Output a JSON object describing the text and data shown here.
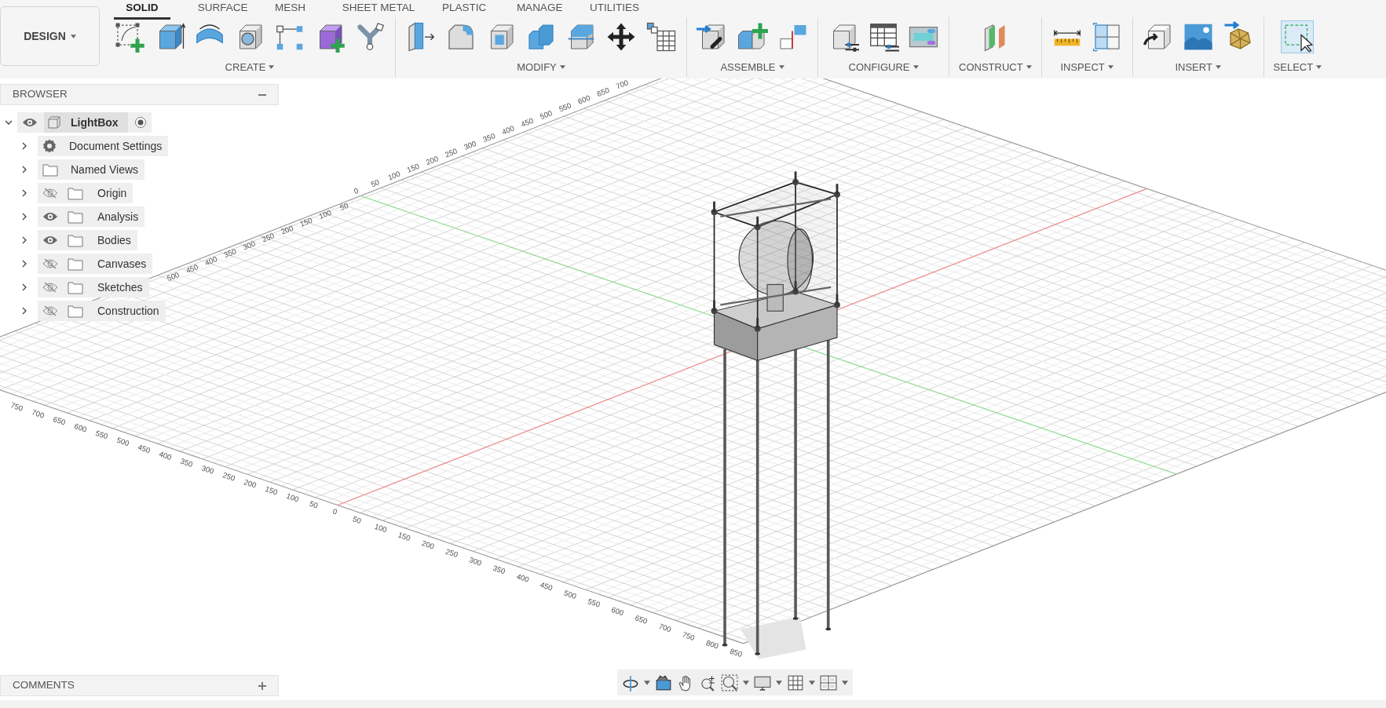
{
  "app_mode": {
    "label": "DESIGN"
  },
  "tabs": [
    {
      "label": "SOLID",
      "selected": true
    },
    {
      "label": "SURFACE",
      "selected": false
    },
    {
      "label": "MESH",
      "selected": false
    },
    {
      "label": "SHEET METAL",
      "selected": false
    },
    {
      "label": "PLASTIC",
      "selected": false
    },
    {
      "label": "MANAGE",
      "selected": false
    },
    {
      "label": "UTILITIES",
      "selected": false
    }
  ],
  "tool_groups": [
    {
      "label": "CREATE"
    },
    {
      "label": "MODIFY"
    },
    {
      "label": "ASSEMBLE"
    },
    {
      "label": "CONFIGURE"
    },
    {
      "label": "CONSTRUCT"
    },
    {
      "label": "INSPECT"
    },
    {
      "label": "INSERT"
    },
    {
      "label": "SELECT",
      "selected": true
    }
  ],
  "browser": {
    "title": "BROWSER",
    "root": {
      "label": "LightBox",
      "expanded": true,
      "visible": true,
      "active": true,
      "children": [
        {
          "kind": "settings",
          "label": "Document Settings",
          "expanded": false
        },
        {
          "kind": "views",
          "label": "Named Views",
          "expanded": false
        },
        {
          "kind": "folder",
          "label": "Origin",
          "expanded": false,
          "visible": false
        },
        {
          "kind": "folder",
          "label": "Analysis",
          "expanded": false,
          "visible": true
        },
        {
          "kind": "folder",
          "label": "Bodies",
          "expanded": false,
          "visible": true
        },
        {
          "kind": "folder",
          "label": "Canvases",
          "expanded": false,
          "visible": false
        },
        {
          "kind": "folder",
          "label": "Sketches",
          "expanded": false,
          "visible": false
        },
        {
          "kind": "folder",
          "label": "Construction",
          "expanded": false,
          "visible": false
        }
      ]
    }
  },
  "viewport": {
    "rulers": [
      {
        "labels": [
          "0",
          "50",
          "100",
          "150",
          "200",
          "250",
          "300",
          "350",
          "400",
          "450",
          "500",
          "550",
          "600",
          "650",
          "700",
          "750"
        ]
      },
      {
        "labels": [
          "50",
          "100",
          "150",
          "200",
          "250",
          "300",
          "350",
          "400",
          "450",
          "500",
          "550",
          "600",
          "650",
          "700",
          "750",
          "800",
          "850"
        ]
      },
      {
        "labels": [
          "0",
          "50",
          "100",
          "150",
          "200",
          "250",
          "300",
          "350",
          "400",
          "450",
          "500",
          "550",
          "600",
          "650",
          "700"
        ]
      },
      {
        "labels": [
          "50",
          "100",
          "150",
          "200",
          "250",
          "300",
          "350",
          "400",
          "450",
          "500"
        ]
      }
    ]
  },
  "comments": {
    "title": "COMMENTS"
  }
}
